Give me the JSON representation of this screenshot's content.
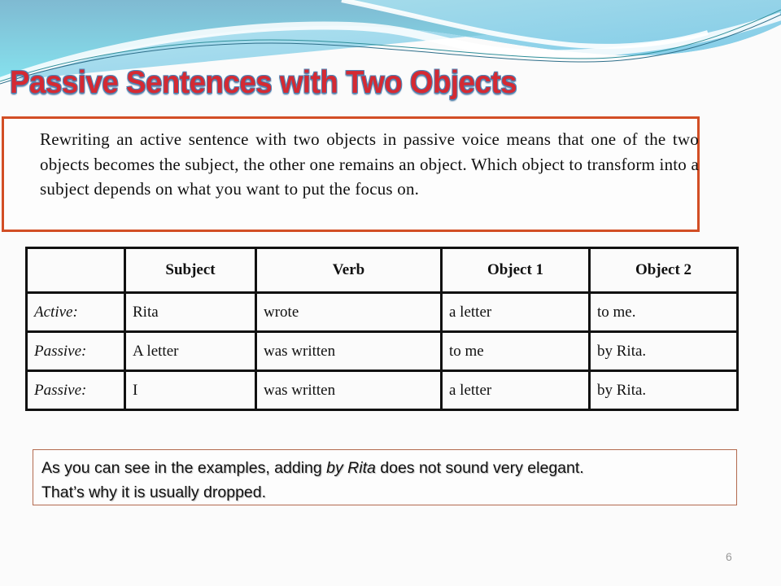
{
  "slide": {
    "title": "Passive Sentences with Two Objects",
    "page_number": "6",
    "colors": {
      "title_fill": "#d42a33",
      "title_outline": "#4b86b8",
      "intro_border": "#d24e25",
      "note_border": "#b36a4f",
      "wave_light": "#7fe0ec",
      "wave_dark": "#7ab6cf"
    }
  },
  "intro": {
    "text": "Rewriting an active sentence with two objects in passive voice means that one of the two objects becomes the subject, the other one remains an object. Which object to transform into a subject depends on what you want to put the focus on."
  },
  "table": {
    "headers": [
      "",
      "Subject",
      "Verb",
      "Object 1",
      "Object 2"
    ],
    "rows": [
      {
        "label": "Active:",
        "cells": [
          "Rita",
          "wrote",
          "a letter",
          "to me."
        ]
      },
      {
        "label": "Passive:",
        "cells": [
          "A letter",
          "was written",
          "to me",
          "by Rita."
        ]
      },
      {
        "label": "Passive:",
        "cells": [
          "I",
          "was written",
          "a letter",
          "by Rita."
        ]
      }
    ]
  },
  "note": {
    "line1_before": "As you can see in the examples, adding ",
    "line1_emphasis": "by Rita",
    "line1_after": " does not sound very elegant.",
    "line2": "That’s why it is usually dropped."
  }
}
